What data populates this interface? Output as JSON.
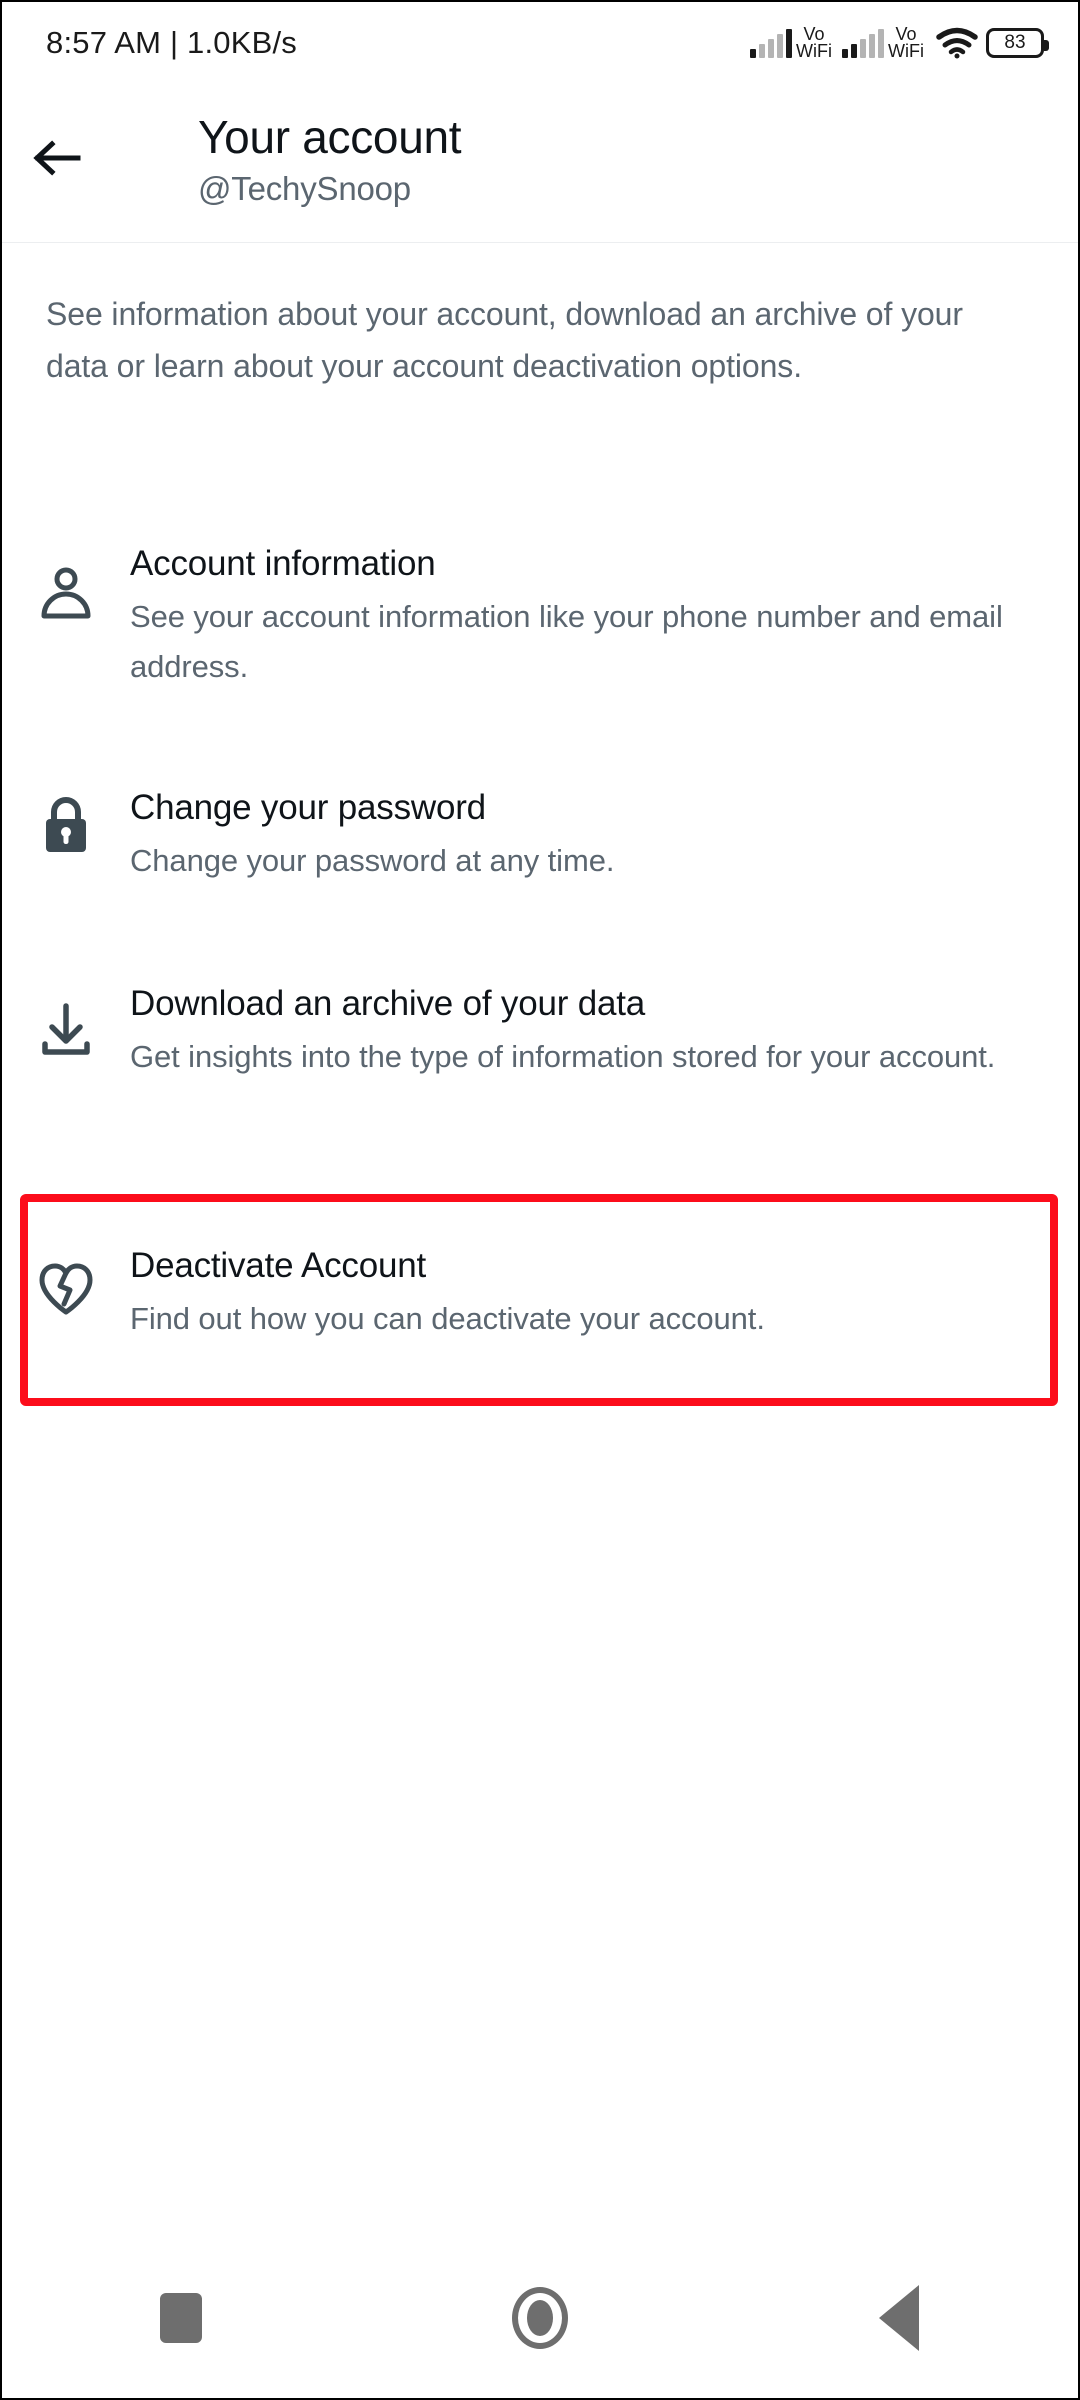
{
  "status_bar": {
    "time_and_speed": "8:57 AM | 1.0KB/s",
    "signal_label_1": {
      "line1": "Vo",
      "line2": "WiFi"
    },
    "signal_label_2": {
      "line1": "Vo",
      "line2": "WiFi"
    },
    "wifi_icon": "wifi-icon",
    "battery_level": "83"
  },
  "header": {
    "back_icon": "back-arrow-icon",
    "title": "Your account",
    "handle": "@TechySnoop"
  },
  "description": "See information about your account, download an archive of your data or learn about your account deactivation options.",
  "items": [
    {
      "icon": "person-icon",
      "title": "Account information",
      "subtitle": "See your account information like your phone number and email address."
    },
    {
      "icon": "lock-icon",
      "title": "Change your password",
      "subtitle": "Change your password at any time."
    },
    {
      "icon": "download-icon",
      "title": "Download an archive of your data",
      "subtitle": "Get insights into the type of information stored for your account."
    },
    {
      "icon": "broken-heart-icon",
      "title": "Deactivate Account",
      "subtitle": "Find out how you can deactivate your account."
    }
  ],
  "highlight": {
    "target": "Deactivate Account",
    "color": "#fc0d1b"
  },
  "nav_bar": {
    "recents_icon": "square-recents-icon",
    "home_icon": "circle-home-icon",
    "back_icon": "triangle-back-icon"
  },
  "colors": {
    "text_primary": "#0f1419",
    "text_secondary": "#5b6670",
    "background": "#ffffff",
    "icon": "#3d4a52",
    "nav_icon": "#6e6e6e",
    "highlight": "#fc0d1b"
  }
}
